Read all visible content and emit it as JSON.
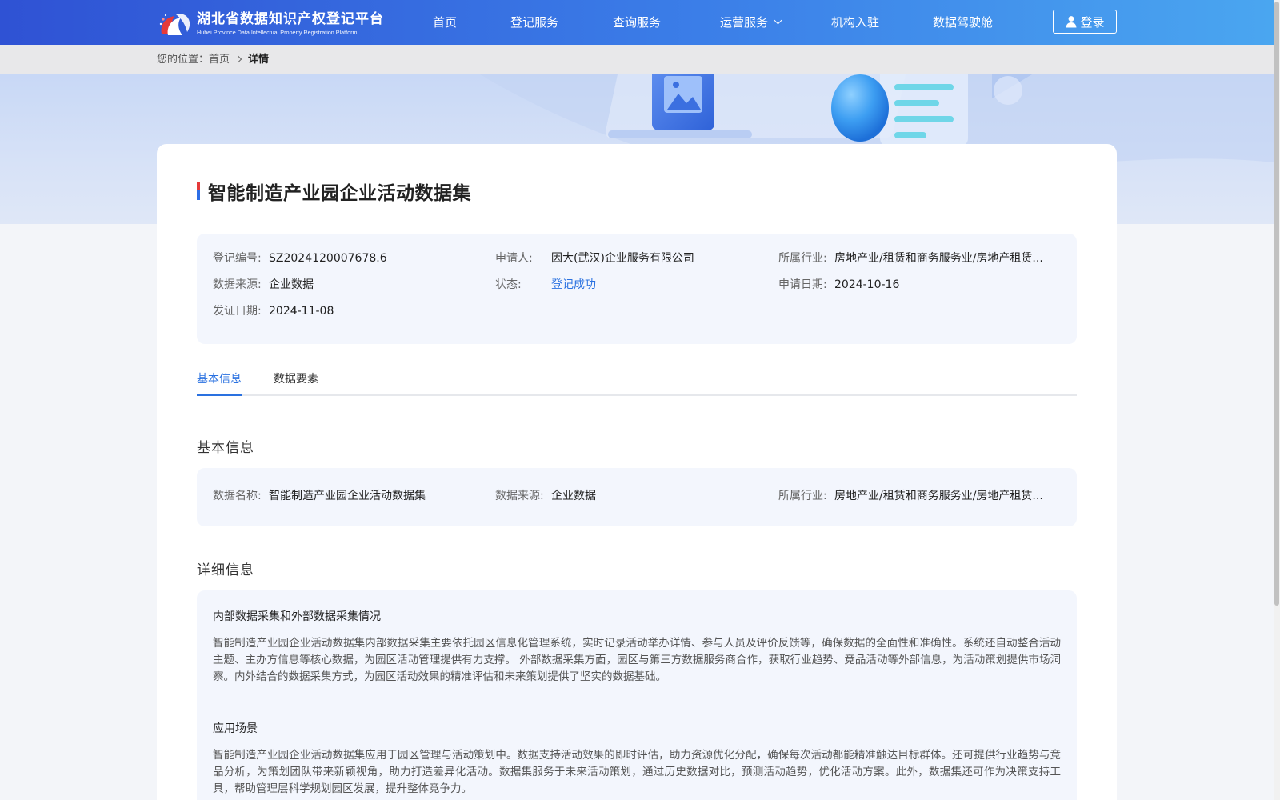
{
  "header": {
    "logo_cn": "湖北省数据知识产权登记平台",
    "logo_en": "Hubei Province Data Intellectual Property Registration Platform",
    "nav": [
      {
        "label": "首页"
      },
      {
        "label": "登记服务"
      },
      {
        "label": "查询服务"
      },
      {
        "label": "运营服务",
        "has_dropdown": true
      },
      {
        "label": "机构入驻"
      },
      {
        "label": "数据驾驶舱"
      }
    ],
    "login_label": "登录",
    "colors": {
      "gradient_start": "#2f52d4",
      "gradient_end": "#4aa6f0"
    }
  },
  "breadcrumb": {
    "prefix": "您的位置：",
    "home": "首页",
    "current": "详情"
  },
  "detail": {
    "title": "智能制造产业园企业活动数据集",
    "summary": {
      "reg_no_label": "登记编号:",
      "reg_no": "SZ2024120007678.6",
      "applicant_label": "申请人:",
      "applicant": "因大(武汉)企业服务有限公司",
      "industry_label": "所属行业:",
      "industry": "房地产业/租赁和商务服务业/房地产租赁...",
      "source_label": "数据来源:",
      "source": "企业数据",
      "status_label": "状态:",
      "status": "登记成功",
      "apply_date_label": "申请日期:",
      "apply_date": "2024-10-16",
      "issue_date_label": "发证日期:",
      "issue_date": "2024-11-08"
    },
    "tabs": [
      {
        "label": "基本信息",
        "active": true
      },
      {
        "label": "数据要素",
        "active": false
      }
    ],
    "basic": {
      "section_title": "基本信息",
      "name_label": "数据名称:",
      "name": "智能制造产业园企业活动数据集",
      "source_label": "数据来源:",
      "source": "企业数据",
      "industry_label": "所属行业:",
      "industry": "房地产业/租赁和商务服务业/房地产租赁..."
    },
    "more": {
      "section_title": "详细信息",
      "collect_title": "内部数据采集和外部数据采集情况",
      "collect_text": "智能制造产业园企业活动数据集内部数据采集主要依托园区信息化管理系统，实时记录活动举办详情、参与人员及评价反馈等，确保数据的全面性和准确性。系统还自动整合活动主题、主办方信息等核心数据，为园区活动管理提供有力支撑。 外部数据采集方面，园区与第三方数据服务商合作，获取行业趋势、竞品活动等外部信息，为活动策划提供市场洞察。内外结合的数据采集方式，为园区活动效果的精准评估和未来策划提供了坚实的数据基础。",
      "scene_title": "应用场景",
      "scene_text": "智能制造产业园企业活动数据集应用于园区管理与活动策划中。数据支持活动效果的即时评估，助力资源优化分配，确保每次活动都能精准触达目标群体。还可提供行业趋势与竞品分析，为策划团队带来新颖视角，助力打造差异化活动。数据集服务于未来活动策划，通过历史数据对比，预测活动趋势，优化活动方案。此外，数据集还可作为决策支持工具，帮助管理层科学规划园区发展，提升整体竞争力。"
    }
  },
  "accent_color": "#2a71e0"
}
